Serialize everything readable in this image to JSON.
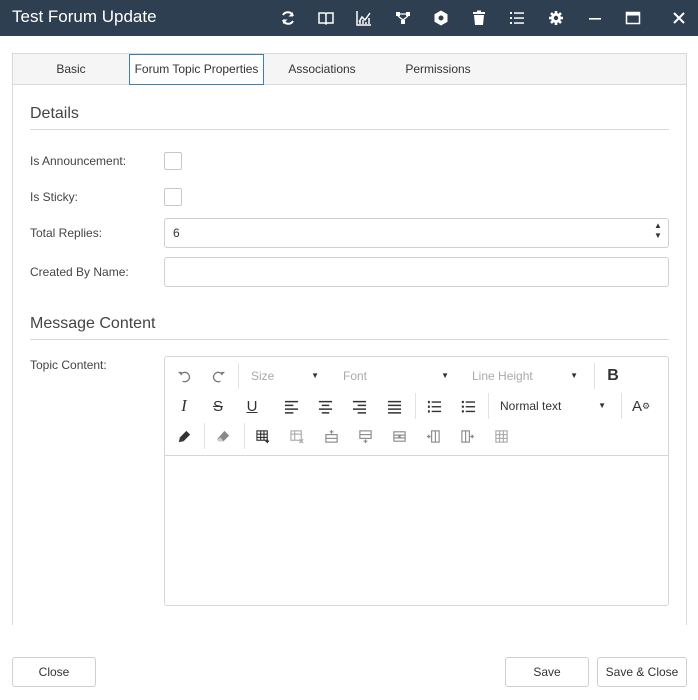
{
  "window": {
    "title": "Test Forum Update"
  },
  "titlebar_icons": [
    "refresh-icon",
    "book-icon",
    "chart-icon",
    "network-icon",
    "settings-badge-icon",
    "trash-icon",
    "list-icon",
    "gear-icon",
    "minimize-icon",
    "maximize-icon",
    "close-icon"
  ],
  "tabs": [
    {
      "label": "Basic",
      "active": false
    },
    {
      "label": "Forum Topic Properties",
      "active": true
    },
    {
      "label": "Associations",
      "active": false
    },
    {
      "label": "Permissions",
      "active": false
    }
  ],
  "details": {
    "title": "Details",
    "is_announcement_label": "Is Announcement:",
    "is_sticky_label": "Is Sticky:",
    "total_replies_label": "Total Replies:",
    "total_replies_value": "6",
    "created_by_name_label": "Created By Name:",
    "created_by_name_value": ""
  },
  "message": {
    "title": "Message Content",
    "topic_content_label": "Topic Content:"
  },
  "editor": {
    "size_label": "Size",
    "font_label": "Font",
    "line_height_label": "Line Height",
    "paragraph_format": "Normal text",
    "bold": "B",
    "italic": "I",
    "strike": "S",
    "underline": "U",
    "font_case": "A"
  },
  "footer": {
    "close_label": "Close",
    "save_label": "Save",
    "save_close_label": "Save & Close"
  },
  "colors": {
    "titlebar": "#2f3f52",
    "active_tab_border": "#3c7fb1"
  }
}
